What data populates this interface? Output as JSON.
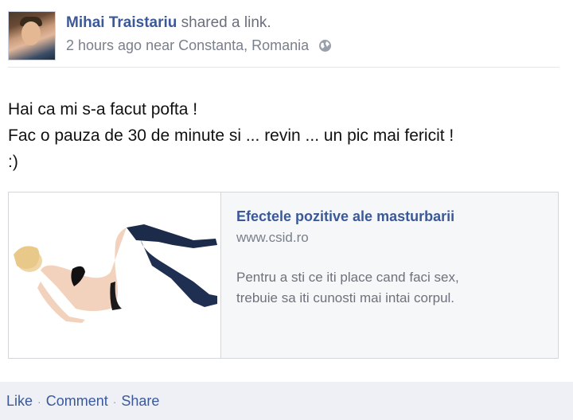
{
  "post": {
    "author": "Mihai Traistariu",
    "action": "shared a link.",
    "timestamp": "2 hours ago near Constanta, Romania",
    "privacy_icon": "globe-icon",
    "message_lines": [
      "Hai ca mi s-a facut pofta !",
      "Fac o pauza de 30 de minute si ... revin ... un pic mai fericit !",
      ":)"
    ]
  },
  "attachment": {
    "title": "Efectele pozitive ale masturbarii",
    "domain": "www.csid.ro",
    "description_lines": [
      "Pentru a sti ce iti place cand faci sex,",
      "trebuie sa iti cunosti mai intai corpul."
    ]
  },
  "footer": {
    "like": "Like",
    "comment": "Comment",
    "share": "Share",
    "separator": "·"
  },
  "colors": {
    "link": "#3b5998",
    "muted": "#7a7f8c",
    "footer_bg": "#eef0f5"
  }
}
